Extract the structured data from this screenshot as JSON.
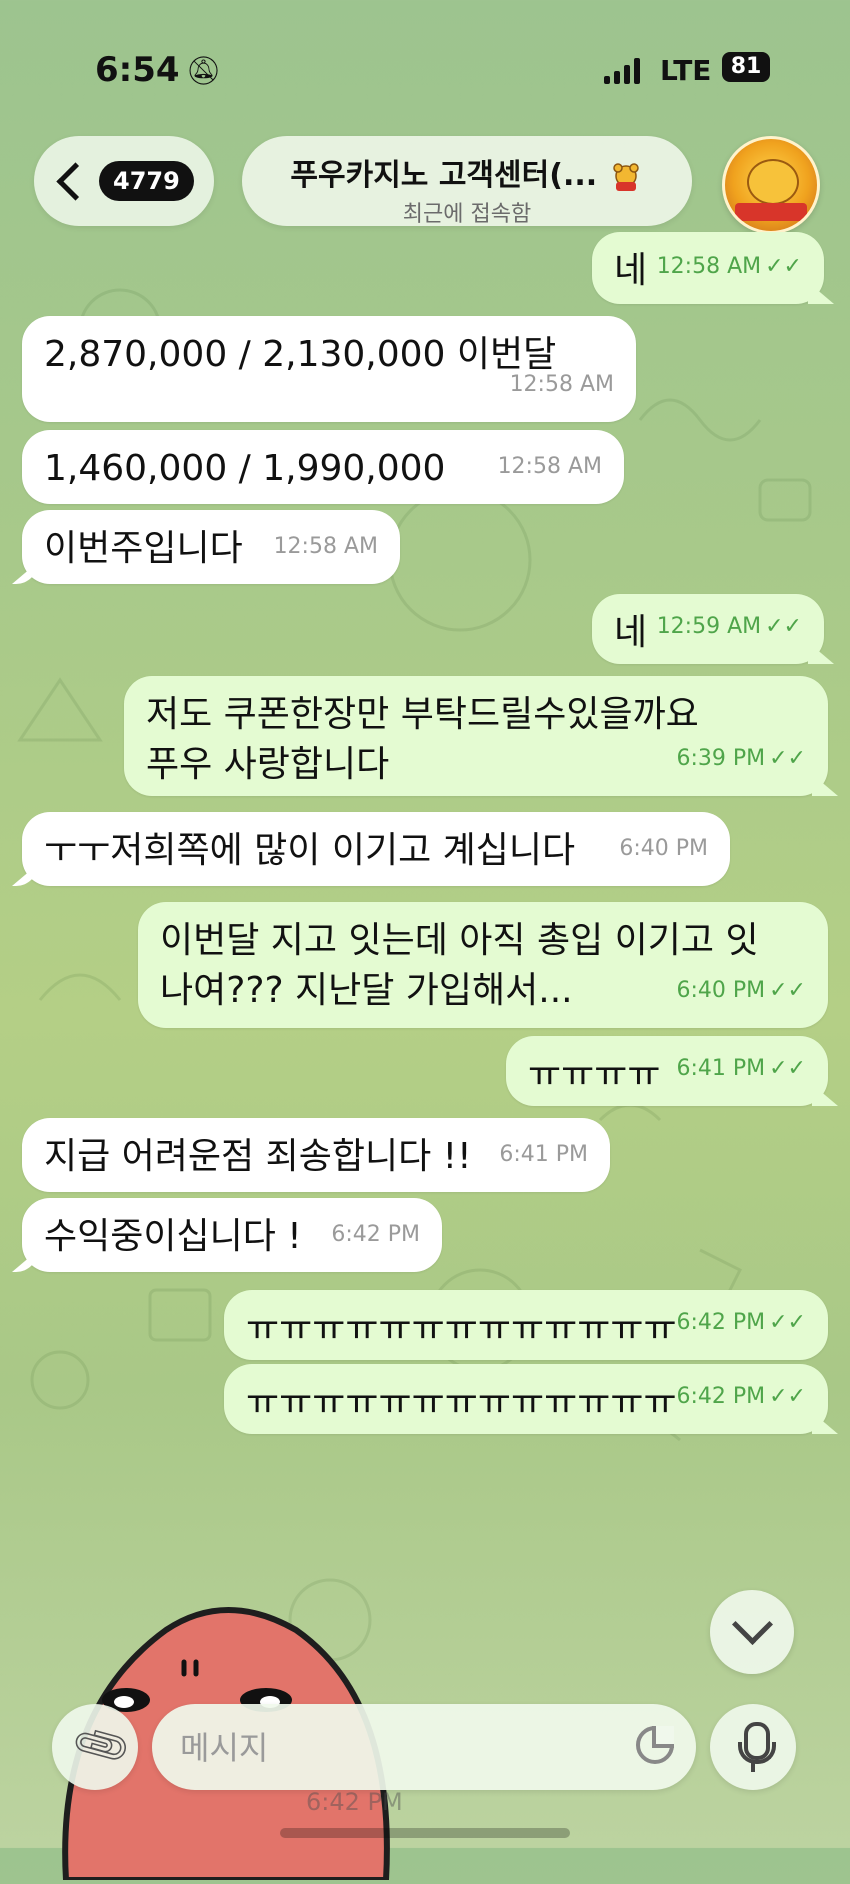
{
  "status_bar": {
    "time": "6:54",
    "network": "LTE",
    "battery": "81"
  },
  "header": {
    "back_count": "4779",
    "title": "푸우카지노 고객센터(...",
    "subtitle": "최근에 접속함"
  },
  "messages": [
    {
      "dir": "out",
      "text": "네",
      "time": "12:58 AM"
    },
    {
      "dir": "in",
      "text": "2,870,000 / 2,130,000 이번달",
      "time": "12:58 AM"
    },
    {
      "dir": "in",
      "text": "1,460,000 / 1,990,000",
      "time": "12:58 AM"
    },
    {
      "dir": "in",
      "text": "이번주입니다",
      "time": "12:58 AM"
    },
    {
      "dir": "out",
      "text": "네",
      "time": "12:59 AM"
    },
    {
      "dir": "out",
      "text": "저도 쿠폰한장만 부탁드릴수있을까요 푸우 사랑합니다",
      "time": "6:39 PM"
    },
    {
      "dir": "in",
      "text": "ㅜㅜ저희쪽에 많이 이기고 계십니다",
      "time": "6:40 PM"
    },
    {
      "dir": "out",
      "text": "이번달 지고 잇는데 아직 총입 이기고 잇나여??? 지난달 가입해서...",
      "time": "6:40 PM"
    },
    {
      "dir": "out",
      "text": "ㅠㅠㅠㅠ",
      "time": "6:41 PM"
    },
    {
      "dir": "in",
      "text": "지급 어려운점 죄송합니다 !!",
      "time": "6:41 PM"
    },
    {
      "dir": "in",
      "text": "수익중이십니다 !",
      "time": "6:42 PM"
    },
    {
      "dir": "out",
      "text": "ㅠㅠㅠㅠㅠㅠㅠㅠㅠㅠㅠㅠㅠ",
      "time": "6:42 PM"
    },
    {
      "dir": "out",
      "text": "ㅠㅠㅠㅠㅠㅠㅠㅠㅠㅠㅠㅠㅠ",
      "time": "6:42 PM"
    }
  ],
  "sticker_time": "6:42 PM",
  "composer": {
    "placeholder": "메시지"
  },
  "icons": {
    "back": "chevron-left-icon",
    "mute": "bell-slash-icon",
    "attach": "paperclip-icon",
    "sticker": "sticker-icon",
    "mic": "microphone-icon",
    "scroll": "chevron-down-icon"
  },
  "colors": {
    "incoming_bubble": "#ffffff",
    "outgoing_bubble": "#e4fbd2",
    "outgoing_time": "#4fa54a"
  }
}
